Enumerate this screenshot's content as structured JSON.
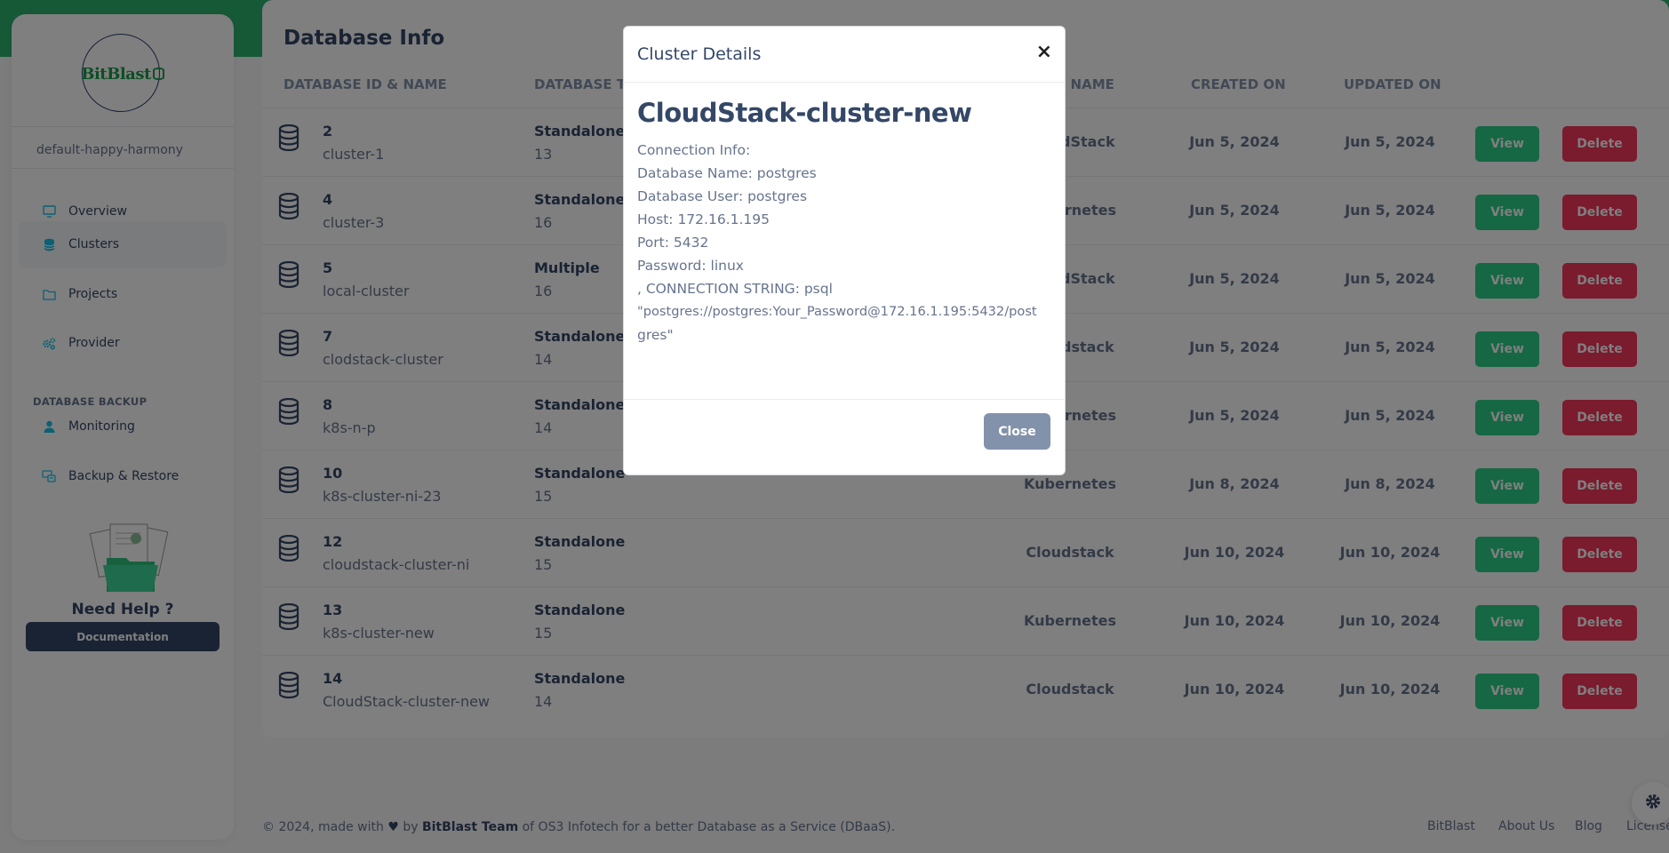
{
  "brand": {
    "name": "BitBlast"
  },
  "workspace": "default-happy-harmony",
  "nav": [
    {
      "label": "Overview",
      "icon": "monitor-icon"
    },
    {
      "label": "Clusters",
      "icon": "database-icon"
    },
    {
      "label": "Projects",
      "icon": "folder-icon"
    },
    {
      "label": "Provider",
      "icon": "gears-icon"
    }
  ],
  "backup_section": {
    "title": "DATABASE BACKUP",
    "items": [
      {
        "label": "Monitoring",
        "icon": "user-icon"
      },
      {
        "label": "Backup & Restore",
        "icon": "backup-icon"
      }
    ]
  },
  "help": {
    "title": "Need Help ?",
    "button": "Documentation"
  },
  "page": {
    "title": "Database Info",
    "columns": [
      "DATABASE ID & NAME",
      "DATABASE TYPE",
      "PROVIDER NAME",
      "CREATED ON",
      "UPDATED ON"
    ],
    "view_label": "View",
    "delete_label": "Delete",
    "rows": [
      {
        "id": "2",
        "name": "cluster-1",
        "type": "Standalone",
        "version": "13",
        "provider": "CloudStack",
        "created": "Jun 5, 2024",
        "updated": "Jun 5, 2024"
      },
      {
        "id": "4",
        "name": "cluster-3",
        "type": "Standalone",
        "version": "16",
        "provider": "Kubernetes",
        "created": "Jun 5, 2024",
        "updated": "Jun 5, 2024"
      },
      {
        "id": "5",
        "name": "local-cluster",
        "type": "Multiple",
        "version": "16",
        "provider": "CloudStack",
        "created": "Jun 5, 2024",
        "updated": "Jun 5, 2024"
      },
      {
        "id": "7",
        "name": "clodstack-cluster",
        "type": "Standalone",
        "version": "14",
        "provider": "Cloudstack",
        "created": "Jun 5, 2024",
        "updated": "Jun 5, 2024"
      },
      {
        "id": "8",
        "name": "k8s-n-p",
        "type": "Standalone",
        "version": "14",
        "provider": "Kubernetes",
        "created": "Jun 5, 2024",
        "updated": "Jun 5, 2024"
      },
      {
        "id": "10",
        "name": "k8s-cluster-ni-23",
        "type": "Standalone",
        "version": "15",
        "provider": "Kubernetes",
        "created": "Jun 8, 2024",
        "updated": "Jun 8, 2024"
      },
      {
        "id": "12",
        "name": "cloudstack-cluster-ni",
        "type": "Standalone",
        "version": "15",
        "provider": "Cloudstack",
        "created": "Jun 10, 2024",
        "updated": "Jun 10, 2024"
      },
      {
        "id": "13",
        "name": "k8s-cluster-new",
        "type": "Standalone",
        "version": "15",
        "provider": "Kubernetes",
        "created": "Jun 10, 2024",
        "updated": "Jun 10, 2024"
      },
      {
        "id": "14",
        "name": "CloudStack-cluster-new",
        "type": "Standalone",
        "version": "14",
        "provider": "Cloudstack",
        "created": "Jun 10, 2024",
        "updated": "Jun 10, 2024"
      }
    ]
  },
  "footer": {
    "prefix": "© 2024, made with",
    "by": "by",
    "team": "BitBlast Team",
    "suffix": "of OS3 Infotech for a better Database as a Service (DBaaS).",
    "links": [
      "BitBlast",
      "About Us",
      "Blog",
      "License"
    ]
  },
  "modal": {
    "title": "Cluster Details",
    "cluster_name": "CloudStack-cluster-new",
    "lines": [
      "Connection Info:",
      "Database Name: postgres",
      "Database User: postgres",
      "Host: 172.16.1.195",
      "Port: 5432",
      "Password: linux",
      ", CONNECTION STRING: psql",
      "\"postgres://postgres:Your_Password@172.16.1.195:5432/post",
      "gres\""
    ],
    "close_label": "Close"
  },
  "colors": {
    "accent": "#2db36f",
    "view": "#2dce89",
    "delete": "#f5365c",
    "primary_dark": "#344767"
  }
}
